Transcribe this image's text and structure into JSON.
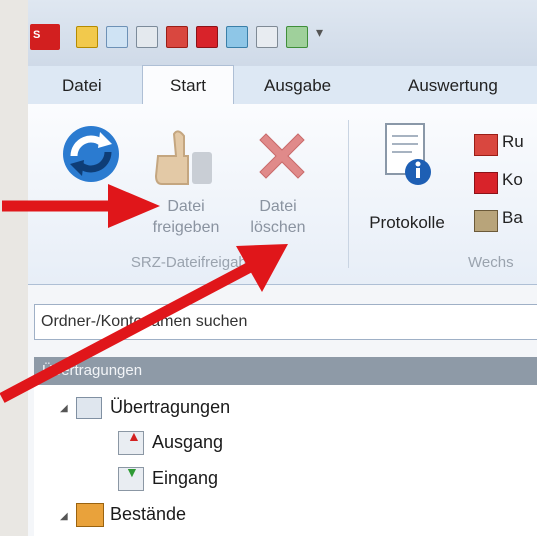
{
  "tabs": [
    "Datei",
    "Start",
    "Ausgabe",
    "Auswertung"
  ],
  "ribbon": {
    "freigeben_label_1": "Datei",
    "freigeben_label_2": "freigeben",
    "loeschen_label_1": "Datei",
    "loeschen_label_2": "löschen",
    "group_left": "SRZ-Dateifreigabe",
    "protokolle_label": "Protokolle",
    "right_items": [
      "Ru",
      "Ko",
      "Ba"
    ],
    "group_right": "Wechs"
  },
  "search": {
    "placeholder": "Ordner-/Kontonamen suchen"
  },
  "nav": {
    "header": "Übertragungen",
    "tree": [
      "Übertragungen",
      "Ausgang",
      "Eingang",
      "Bestände"
    ]
  },
  "colors": {
    "arrow": "#e0161a",
    "accent": "#2c6cbf"
  }
}
